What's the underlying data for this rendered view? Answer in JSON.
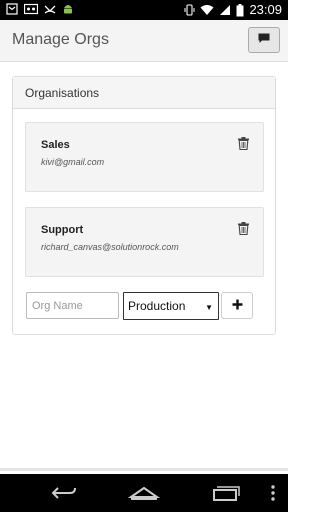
{
  "status_bar": {
    "time": "23:09",
    "icons": [
      "notification-icon",
      "voicemail-icon",
      "missed-call-icon",
      "android-icon",
      "vibrate-icon",
      "wifi-icon",
      "signal-icon",
      "battery-icon"
    ]
  },
  "app_bar": {
    "title": "Manage Orgs",
    "action_icon": "chat-icon"
  },
  "panel": {
    "heading": "Organisations",
    "orgs": [
      {
        "name": "Sales",
        "email": "kivi@gmail.com"
      },
      {
        "name": "Support",
        "email": "richard_canvas@solutionrock.com"
      }
    ]
  },
  "add_form": {
    "name_placeholder": "Org Name",
    "name_value": "",
    "environment_selected": "Production",
    "add_icon": "plus-icon"
  },
  "nav_bar": {
    "icons": [
      "back-icon",
      "home-icon",
      "recents-icon",
      "overflow-menu-icon"
    ]
  }
}
